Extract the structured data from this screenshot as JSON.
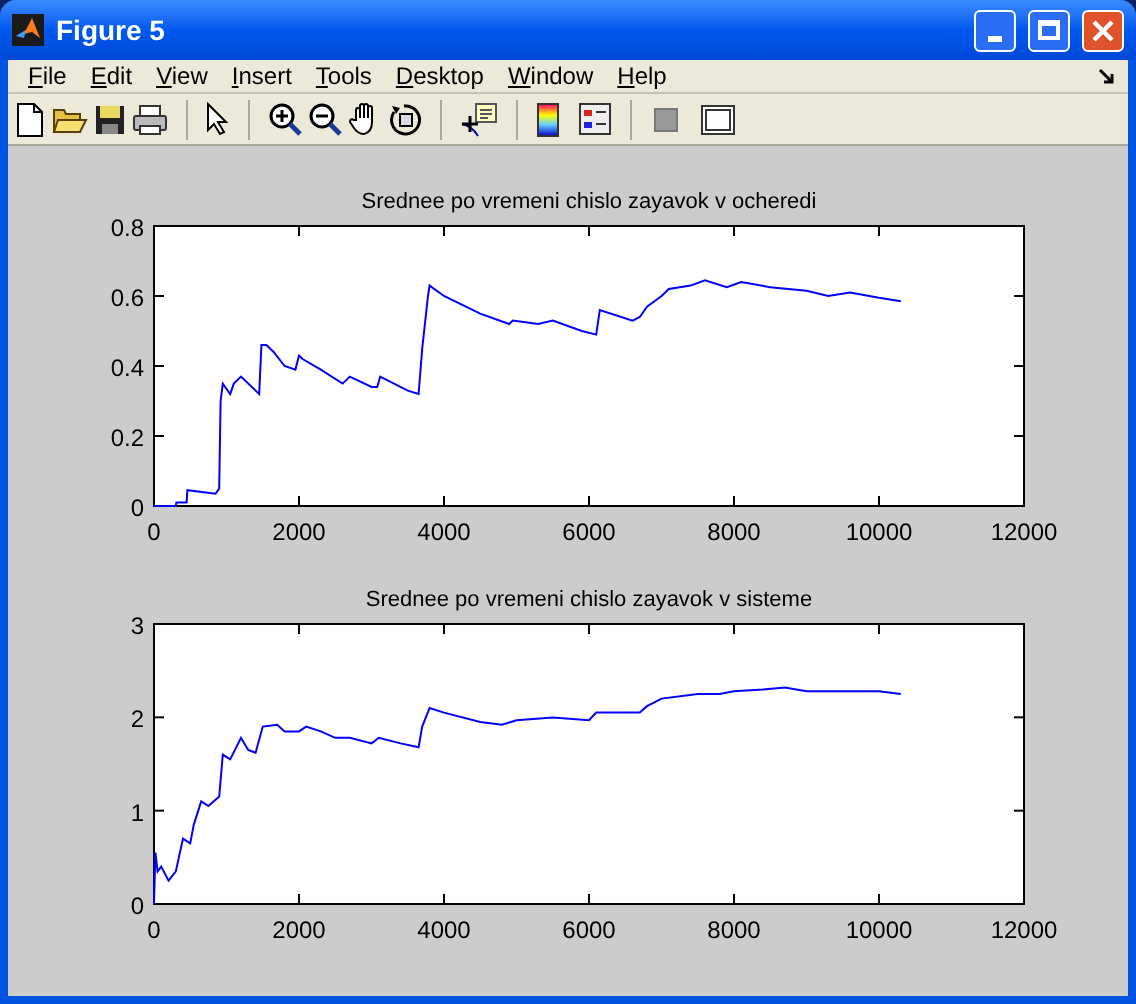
{
  "window": {
    "title": "Figure 5"
  },
  "menu": [
    {
      "label": "File"
    },
    {
      "label": "Edit"
    },
    {
      "label": "View"
    },
    {
      "label": "Insert"
    },
    {
      "label": "Tools"
    },
    {
      "label": "Desktop"
    },
    {
      "label": "Window"
    },
    {
      "label": "Help"
    }
  ],
  "plots": [
    {
      "chart_data": {
        "type": "line",
        "title": "Srednee po vremeni chislo zayavok v ocheredi",
        "xlim": [
          0,
          12000
        ],
        "ylim": [
          0,
          0.8
        ],
        "xticks": [
          0,
          2000,
          4000,
          6000,
          8000,
          10000,
          12000
        ],
        "yticks": [
          0,
          0.2,
          0.4,
          0.6,
          0.8
        ],
        "x": [
          0,
          300,
          310,
          450,
          460,
          850,
          900,
          920,
          950,
          1050,
          1100,
          1200,
          1400,
          1450,
          1480,
          1550,
          1650,
          1800,
          1950,
          2000,
          2050,
          2300,
          2600,
          2700,
          3000,
          3080,
          3120,
          3500,
          3650,
          3700,
          3780,
          3800,
          4000,
          4500,
          4900,
          4950,
          5300,
          5500,
          5900,
          6100,
          6150,
          6600,
          6700,
          6800,
          7000,
          7100,
          7400,
          7600,
          7900,
          8100,
          8500,
          9000,
          9300,
          9600,
          10000,
          10300
        ],
        "series": [
          {
            "color": "#0000ff",
            "values": [
              0,
              0,
              0.01,
              0.01,
              0.045,
              0.035,
              0.05,
              0.3,
              0.35,
              0.32,
              0.35,
              0.37,
              0.33,
              0.32,
              0.46,
              0.46,
              0.44,
              0.4,
              0.39,
              0.43,
              0.42,
              0.39,
              0.35,
              0.37,
              0.34,
              0.34,
              0.37,
              0.33,
              0.32,
              0.45,
              0.6,
              0.63,
              0.6,
              0.55,
              0.52,
              0.53,
              0.52,
              0.53,
              0.5,
              0.49,
              0.56,
              0.53,
              0.54,
              0.57,
              0.6,
              0.62,
              0.63,
              0.645,
              0.625,
              0.64,
              0.625,
              0.615,
              0.6,
              0.61,
              0.595,
              0.585
            ]
          }
        ]
      }
    },
    {
      "chart_data": {
        "type": "line",
        "title": "Srednee po vremeni chislo zayavok v sisteme",
        "xlim": [
          0,
          12000
        ],
        "ylim": [
          0,
          3
        ],
        "xticks": [
          0,
          2000,
          4000,
          6000,
          8000,
          10000,
          12000
        ],
        "yticks": [
          0,
          1,
          2,
          3
        ],
        "x": [
          0,
          20,
          50,
          100,
          200,
          300,
          400,
          500,
          550,
          650,
          750,
          900,
          950,
          1050,
          1200,
          1300,
          1400,
          1500,
          1700,
          1800,
          2000,
          2100,
          2300,
          2500,
          2700,
          3000,
          3100,
          3400,
          3650,
          3700,
          3800,
          4000,
          4500,
          4800,
          5000,
          5500,
          6000,
          6100,
          6700,
          6800,
          7000,
          7500,
          7800,
          8000,
          8400,
          8700,
          9000,
          9500,
          10000,
          10300
        ],
        "series": [
          {
            "color": "#0000ff",
            "values": [
              0,
              0.55,
              0.35,
              0.4,
              0.25,
              0.35,
              0.7,
              0.65,
              0.85,
              1.1,
              1.05,
              1.15,
              1.6,
              1.55,
              1.78,
              1.65,
              1.62,
              1.9,
              1.92,
              1.85,
              1.85,
              1.9,
              1.85,
              1.78,
              1.78,
              1.72,
              1.78,
              1.72,
              1.68,
              1.9,
              2.1,
              2.05,
              1.95,
              1.92,
              1.97,
              2.0,
              1.97,
              2.05,
              2.05,
              2.12,
              2.2,
              2.25,
              2.25,
              2.28,
              2.3,
              2.32,
              2.28,
              2.28,
              2.28,
              2.25
            ]
          }
        ]
      }
    }
  ]
}
